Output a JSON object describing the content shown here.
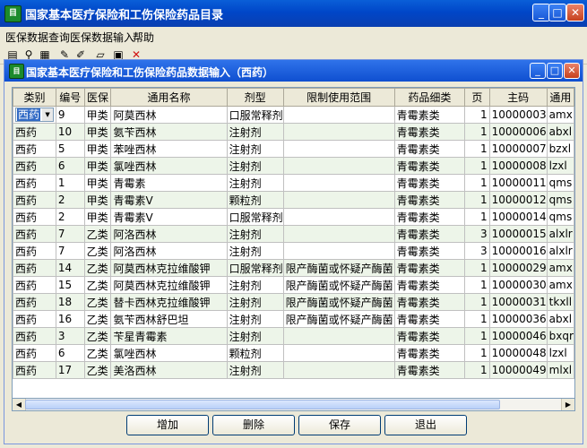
{
  "window": {
    "title": "国家基本医疗保险和工伤保险药品目录",
    "icon_text": "目"
  },
  "menu": [
    "医保数据查询",
    "医保数据输入",
    "帮助"
  ],
  "toolbar": {
    "icons": [
      "book-icon",
      "binoculars-icon",
      "chart-icon",
      "pencil-icon",
      "edit-icon",
      "eraser-icon",
      "picture-icon",
      "delete-icon"
    ],
    "glyphs": [
      "▤",
      "⚲",
      "▦",
      "✎",
      "✐",
      "▱",
      "▣",
      "✕"
    ],
    "delete_color": "#d01010"
  },
  "child": {
    "title": "国家基本医疗保险和工伤保险药品数据输入（西药）"
  },
  "table": {
    "columns": [
      "类别",
      "编号",
      "医保",
      "通用名称",
      "剂型",
      "限制使用范围",
      "药品细类",
      "页",
      "主码",
      "通用"
    ],
    "selected_cell": "西药",
    "rows": [
      [
        "西药",
        "9",
        "甲类",
        "阿莫西林",
        "口服常释剂",
        "",
        "青霉素类",
        "1",
        "10000003",
        "amx"
      ],
      [
        "西药",
        "10",
        "甲类",
        "氨苄西林",
        "注射剂",
        "",
        "青霉素类",
        "1",
        "10000006",
        "abxl"
      ],
      [
        "西药",
        "5",
        "甲类",
        "苯唑西林",
        "注射剂",
        "",
        "青霉素类",
        "1",
        "10000007",
        "bzxl"
      ],
      [
        "西药",
        "6",
        "甲类",
        "氯唑西林",
        "注射剂",
        "",
        "青霉素类",
        "1",
        "10000008",
        "lzxl"
      ],
      [
        "西药",
        "1",
        "甲类",
        "青霉素",
        "注射剂",
        "",
        "青霉素类",
        "1",
        "10000011",
        "qms"
      ],
      [
        "西药",
        "2",
        "甲类",
        "青霉素V",
        "颗粒剂",
        "",
        "青霉素类",
        "1",
        "10000012",
        "qms"
      ],
      [
        "西药",
        "2",
        "甲类",
        "青霉素V",
        "口服常释剂",
        "",
        "青霉素类",
        "1",
        "10000014",
        "qms"
      ],
      [
        "西药",
        "7",
        "乙类",
        "阿洛西林",
        "注射剂",
        "",
        "青霉素类",
        "3",
        "10000015",
        "alxlr"
      ],
      [
        "西药",
        "7",
        "乙类",
        "阿洛西林",
        "注射剂",
        "",
        "青霉素类",
        "3",
        "10000016",
        "alxlr"
      ],
      [
        "西药",
        "14",
        "乙类",
        "阿莫西林克拉维酸钾",
        "口服常释剂",
        "限产酶菌或怀疑产酶菌",
        "青霉素类",
        "1",
        "10000029",
        "amx"
      ],
      [
        "西药",
        "15",
        "乙类",
        "阿莫西林克拉维酸钾",
        "注射剂",
        "限产酶菌或怀疑产酶菌",
        "青霉素类",
        "1",
        "10000030",
        "amx"
      ],
      [
        "西药",
        "18",
        "乙类",
        "替卡西林克拉维酸钾",
        "注射剂",
        "限产酶菌或怀疑产酶菌",
        "青霉素类",
        "1",
        "10000031",
        "tkxll"
      ],
      [
        "西药",
        "16",
        "乙类",
        "氨苄西林舒巴坦",
        "注射剂",
        "限产酶菌或怀疑产酶菌",
        "青霉素类",
        "1",
        "10000036",
        "abxl"
      ],
      [
        "西药",
        "3",
        "乙类",
        "苄星青霉素",
        "注射剂",
        "",
        "青霉素类",
        "1",
        "10000046",
        "bxqr"
      ],
      [
        "西药",
        "6",
        "乙类",
        "氯唑西林",
        "颗粒剂",
        "",
        "青霉素类",
        "1",
        "10000048",
        "lzxl"
      ],
      [
        "西药",
        "17",
        "乙类",
        "美洛西林",
        "注射剂",
        "",
        "青霉素类",
        "1",
        "10000049",
        "mlxl"
      ]
    ]
  },
  "buttons": {
    "add": "增加",
    "delete": "删除",
    "save": "保存",
    "exit": "退出"
  }
}
